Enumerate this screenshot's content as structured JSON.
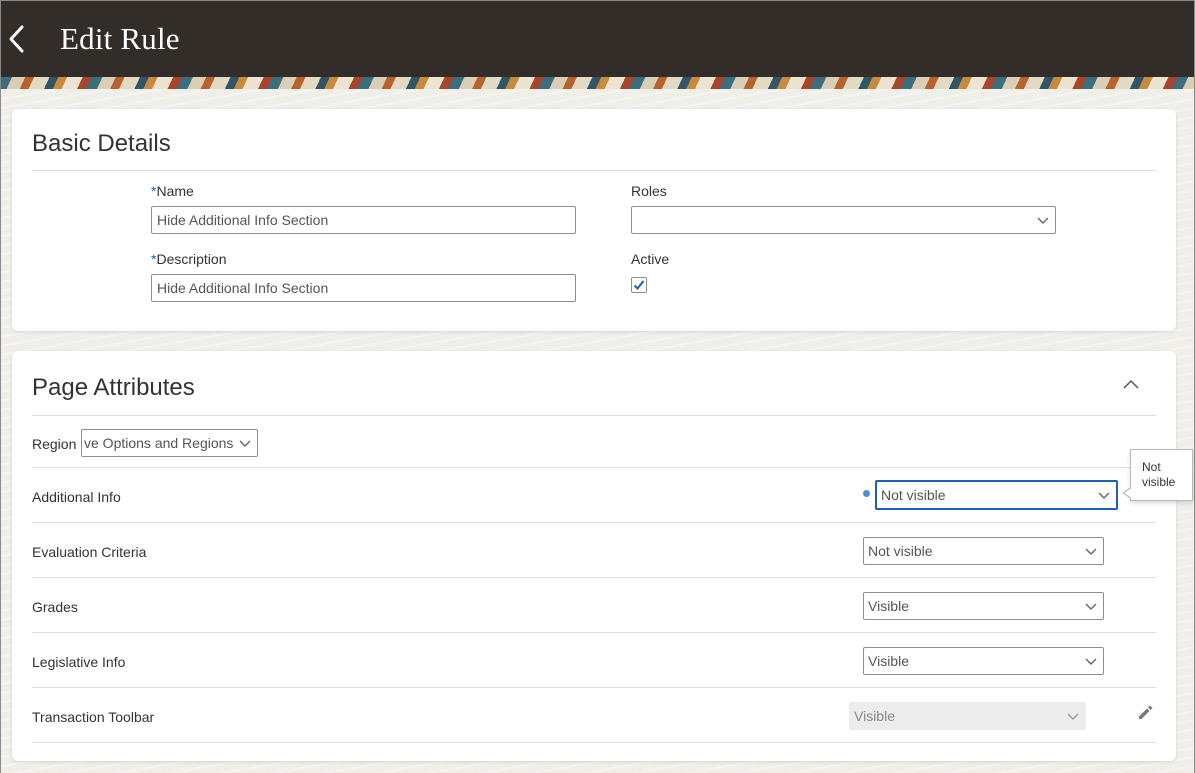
{
  "header": {
    "title": "Edit Rule",
    "back_icon": "chevron-left-icon"
  },
  "basic_details": {
    "title": "Basic Details",
    "name": {
      "required_marker": "*",
      "label": "Name",
      "value": "Hide Additional Info Section"
    },
    "description": {
      "required_marker": "*",
      "label": "Description",
      "value": "Hide Additional Info Section"
    },
    "roles": {
      "label": "Roles",
      "value": ""
    },
    "active": {
      "label": "Active",
      "checked": true
    }
  },
  "page_attributes": {
    "title": "Page Attributes",
    "collapse_icon": "chevron-up-icon",
    "region": {
      "label": "Region",
      "value": "ve Options and Regions"
    },
    "rows": [
      {
        "label": "Additional Info",
        "value": "Not visible"
      },
      {
        "label": "Evaluation Criteria",
        "value": "Not visible"
      },
      {
        "label": "Grades",
        "value": "Visible"
      },
      {
        "label": "Legislative Info",
        "value": "Visible"
      },
      {
        "label": "Transaction Toolbar",
        "value": "Visible"
      }
    ],
    "edit_icon": "pencil-icon"
  },
  "tooltip": {
    "line1": "Not",
    "line2": "visible"
  },
  "colors": {
    "header_bg": "#322d29",
    "accent": "#1b5fb6"
  }
}
